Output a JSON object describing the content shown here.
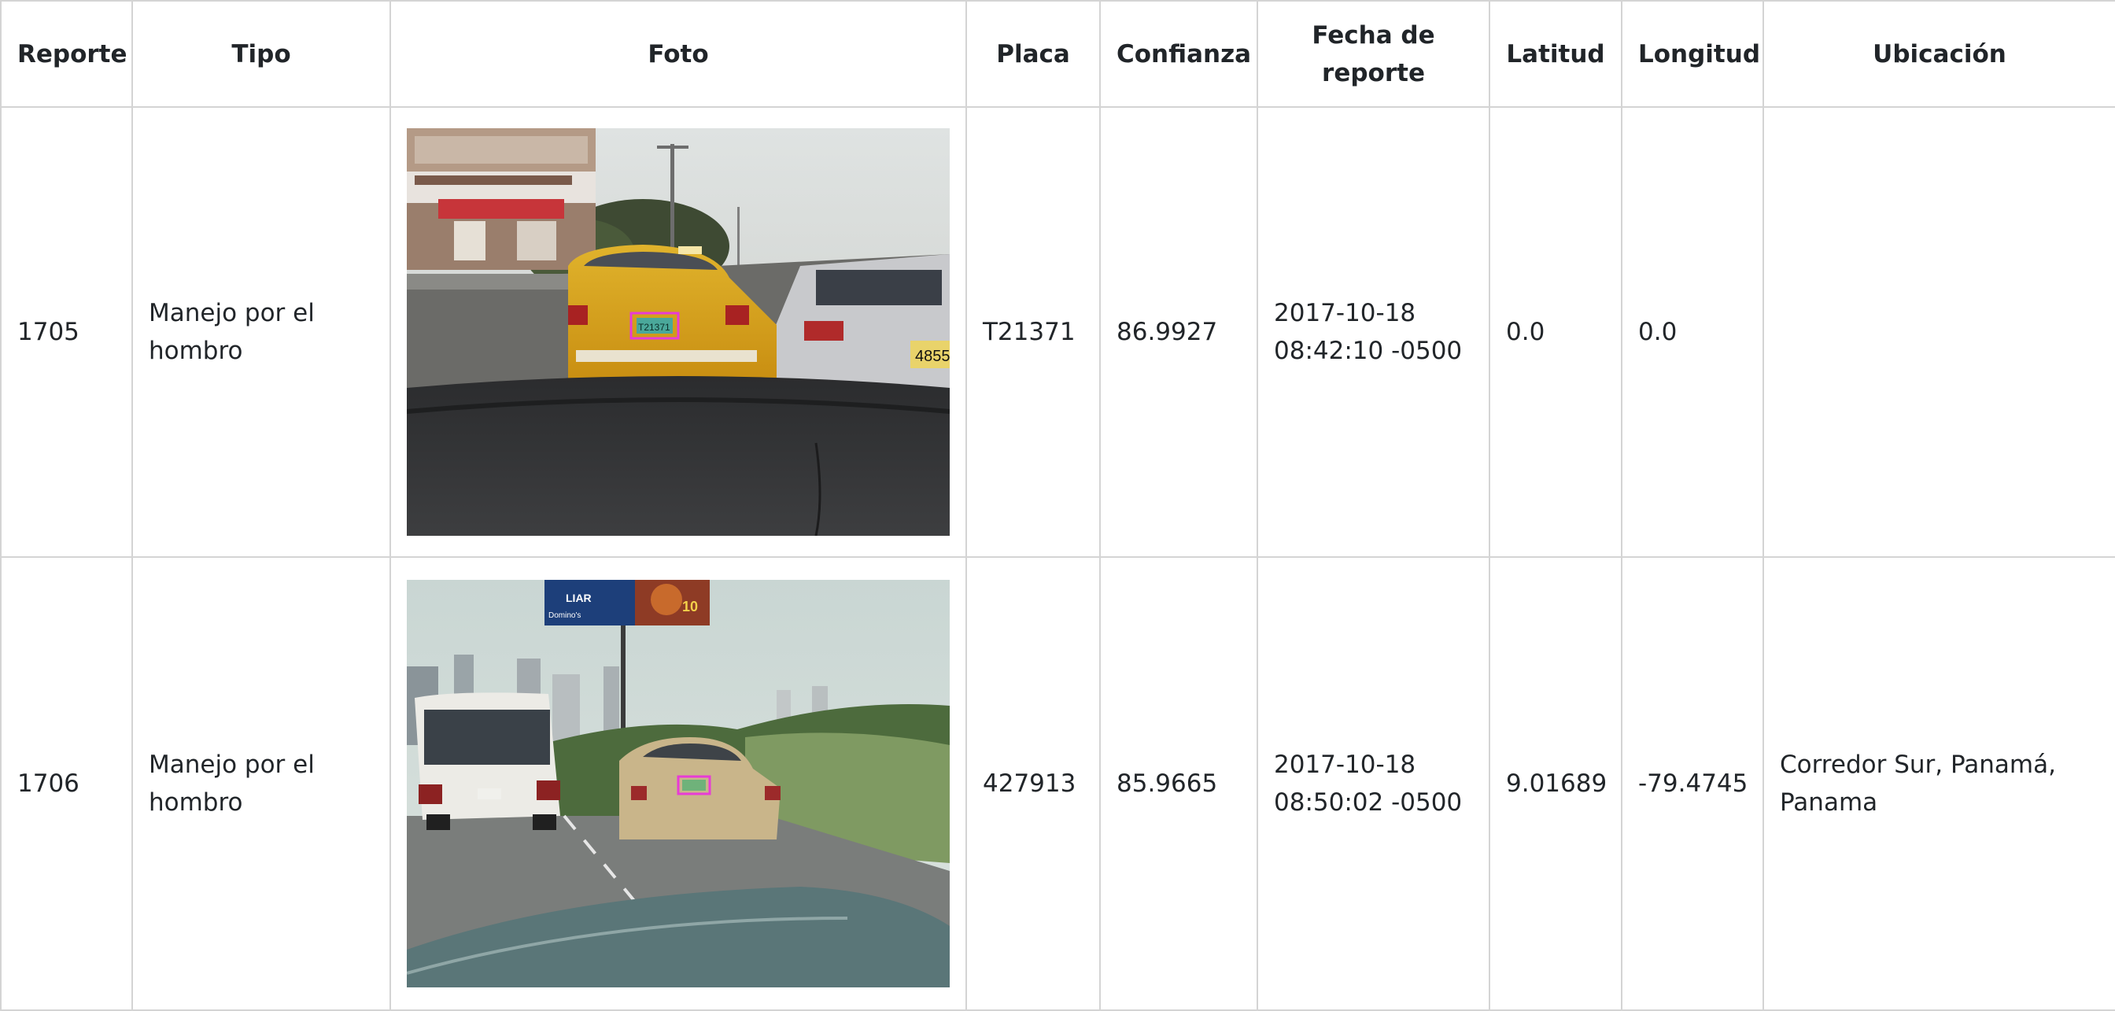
{
  "table": {
    "headers": [
      "Reporte",
      "Tipo",
      "Foto",
      "Placa",
      "Confianza",
      "Fecha de\nreporte",
      "Latitud",
      "Longitud",
      "Ubicación"
    ],
    "rows": [
      {
        "reporte": "1705",
        "tipo": "Manejo por el\nhombro",
        "foto": {
          "plate_text": "T21371",
          "other_plate_text": "4855",
          "highlight_color": "#e83bd6"
        },
        "placa": "T21371",
        "confianza": "86.9927",
        "fecha": "2017-10-18\n08:42:10 -0500",
        "latitud": "0.0",
        "longitud": "0.0",
        "ubicacion": ""
      },
      {
        "reporte": "1706",
        "tipo": "Manejo por el\nhombro",
        "foto": {
          "billboard_brand": "Domino's",
          "billboard_text": "LIAR",
          "billboard_price": "10",
          "highlight_color": "#e83bd6"
        },
        "placa": "427913",
        "confianza": "85.9665",
        "fecha": "2017-10-18\n08:50:02 -0500",
        "latitud": "9.01689",
        "longitud": "-79.4745",
        "ubicacion": "Corredor Sur, Panamá,\nPanama"
      }
    ]
  }
}
